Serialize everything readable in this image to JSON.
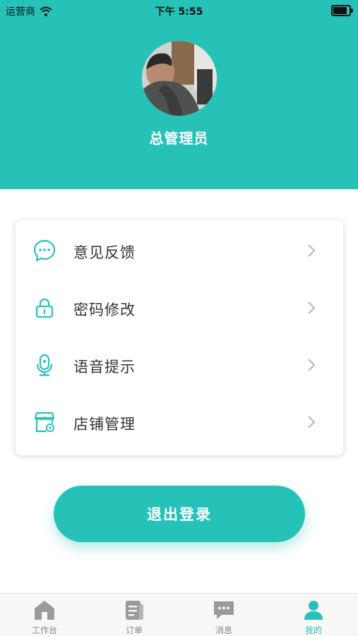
{
  "status_bar": {
    "carrier": "运营商",
    "time": "下午 5:55"
  },
  "profile": {
    "name": "总管理员"
  },
  "menu": [
    {
      "label": "意见反馈",
      "icon": "chat-bubble-icon"
    },
    {
      "label": "密码修改",
      "icon": "lock-icon"
    },
    {
      "label": "语音提示",
      "icon": "microphone-icon"
    },
    {
      "label": "店铺管理",
      "icon": "store-settings-icon"
    }
  ],
  "logout_label": "退出登录",
  "tabs": [
    {
      "label": "工作台",
      "icon": "home-icon"
    },
    {
      "label": "订单",
      "icon": "order-icon"
    },
    {
      "label": "消息",
      "icon": "message-icon"
    },
    {
      "label": "我的",
      "icon": "person-icon",
      "active": true
    }
  ],
  "colors": {
    "accent": "#26c2b8",
    "inactive": "#888888"
  }
}
